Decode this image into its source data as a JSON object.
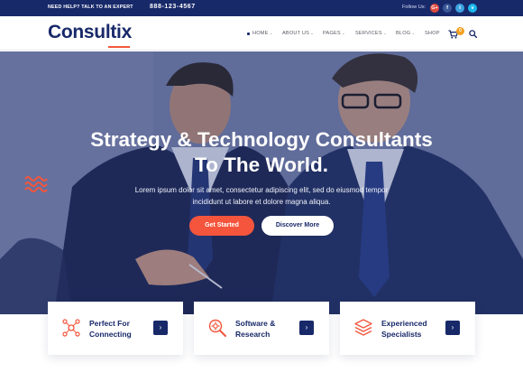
{
  "topbar": {
    "help_text": "NEED HELP? TALK TO AN EXPERT",
    "phone": "888-123-4567",
    "follow_label": "Follow Us:",
    "social": [
      {
        "icon": "google-plus-icon",
        "glyph": "G+"
      },
      {
        "icon": "facebook-icon",
        "glyph": "f"
      },
      {
        "icon": "twitter-icon",
        "glyph": "t"
      },
      {
        "icon": "vimeo-icon",
        "glyph": "v"
      }
    ]
  },
  "header": {
    "logo": "Consultix",
    "nav": [
      {
        "label": "HOME",
        "has_dropdown": true,
        "active": true
      },
      {
        "label": "ABOUT US",
        "has_dropdown": true
      },
      {
        "label": "PAGES",
        "has_dropdown": true
      },
      {
        "label": "SERVICES",
        "has_dropdown": true
      },
      {
        "label": "BLOG",
        "has_dropdown": true
      },
      {
        "label": "SHOP",
        "has_dropdown": false
      }
    ],
    "cart_count": "0",
    "colors": {
      "brand": "#18296a",
      "accent": "#f4553c",
      "badge": "#f4a020"
    }
  },
  "hero": {
    "title_line1": "Strategy & Technology Consultants",
    "title_line2": "To The World.",
    "subtitle_line1": "Lorem ipsum dolor sit amet, consectetur adipiscing elit, sed do eiusmod tempor",
    "subtitle_line2": "incididunt ut labore et dolore magna aliqua.",
    "primary_button": "Get Started",
    "secondary_button": "Discover More"
  },
  "features": [
    {
      "line1": "Perfect For",
      "line2": "Connecting",
      "icon": "network-nodes-icon",
      "arrow": "›"
    },
    {
      "line1": "Software &",
      "line2": "Research",
      "icon": "magnifier-gear-icon",
      "arrow": "›"
    },
    {
      "line1": "Experienced",
      "line2": "Specialists",
      "icon": "layers-icon",
      "arrow": "›"
    }
  ]
}
